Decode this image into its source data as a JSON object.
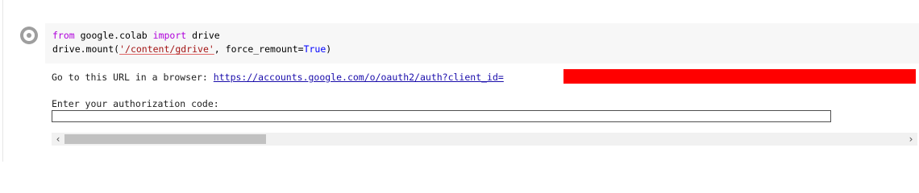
{
  "cell": {
    "code_lines": [
      {
        "kw1": "from",
        "mid1": " google.colab ",
        "kw2": "import",
        "rest": " drive"
      },
      {
        "pre": "drive.mount(",
        "str": "'/content/gdrive'",
        "mid": ", force_remount=",
        "bool": "True",
        "post": ")"
      }
    ]
  },
  "output": {
    "url_prefix": "Go to this URL in a browser: ",
    "url_text": "https://accounts.google.com/o/oauth2/auth?client_id=",
    "prompt_label": "Enter your authorization code:",
    "auth_input_value": ""
  },
  "scrollbar": {
    "left_arrow": "‹",
    "right_arrow": "›",
    "thumb_fraction": 0.24
  },
  "colors": {
    "keyword": "#af00db",
    "string": "#a31515",
    "boolean": "#0000ff",
    "link": "#1a0dab",
    "redaction": "#ff0000",
    "editor_bg": "#f7f7f7"
  },
  "icons": {
    "run_button": "stop-circle-icon"
  }
}
